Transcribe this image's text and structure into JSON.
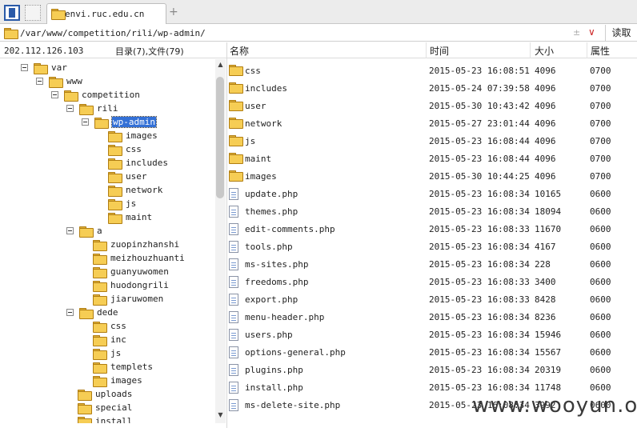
{
  "tabbar": {
    "tab_label": "envi.ruc.edu.cn",
    "add_symbol": "+"
  },
  "pathbar": {
    "path": "/var/www/competition/rili/wp-admin/",
    "star": "±",
    "dropdown": "∨",
    "read_label": "读取"
  },
  "left_header": {
    "ip": "202.112.126.103",
    "counts": "目录(7),文件(79)"
  },
  "tree": [
    {
      "label": "var",
      "expander": true
    },
    {
      "label": "www",
      "expander": true
    },
    {
      "label": "competition",
      "expander": true
    },
    {
      "label": "rili",
      "expander": true
    },
    {
      "label": "wp-admin",
      "expander": true,
      "selected": true
    },
    {
      "label": "images"
    },
    {
      "label": "css"
    },
    {
      "label": "includes"
    },
    {
      "label": "user"
    },
    {
      "label": "network"
    },
    {
      "label": "js"
    },
    {
      "label": "maint"
    },
    {
      "label": "a",
      "expander": true
    },
    {
      "label": "zuopinzhanshi"
    },
    {
      "label": "meizhouzhuanti"
    },
    {
      "label": "guanyuwomen"
    },
    {
      "label": "huodongrili"
    },
    {
      "label": "jiaruwomen"
    },
    {
      "label": "dede",
      "expander": true
    },
    {
      "label": "css"
    },
    {
      "label": "inc"
    },
    {
      "label": "js"
    },
    {
      "label": "templets"
    },
    {
      "label": "images"
    },
    {
      "label": "uploads"
    },
    {
      "label": "special"
    },
    {
      "label": "install"
    }
  ],
  "file_header": {
    "name": "名称",
    "time": "时间",
    "size": "大小",
    "perm": "属性"
  },
  "files": [
    {
      "name": "css",
      "time": "2015-05-23 16:08:51",
      "size": "4096",
      "perm": "0700",
      "type": "folder"
    },
    {
      "name": "includes",
      "time": "2015-05-24 07:39:58",
      "size": "4096",
      "perm": "0700",
      "type": "folder"
    },
    {
      "name": "user",
      "time": "2015-05-30 10:43:42",
      "size": "4096",
      "perm": "0700",
      "type": "folder"
    },
    {
      "name": "network",
      "time": "2015-05-27 23:01:44",
      "size": "4096",
      "perm": "0700",
      "type": "folder"
    },
    {
      "name": "js",
      "time": "2015-05-23 16:08:44",
      "size": "4096",
      "perm": "0700",
      "type": "folder"
    },
    {
      "name": "maint",
      "time": "2015-05-23 16:08:44",
      "size": "4096",
      "perm": "0700",
      "type": "folder"
    },
    {
      "name": "images",
      "time": "2015-05-30 10:44:25",
      "size": "4096",
      "perm": "0700",
      "type": "folder"
    },
    {
      "name": "update.php",
      "time": "2015-05-23 16:08:34",
      "size": "10165",
      "perm": "0600",
      "type": "file"
    },
    {
      "name": "themes.php",
      "time": "2015-05-23 16:08:34",
      "size": "18094",
      "perm": "0600",
      "type": "file"
    },
    {
      "name": "edit-comments.php",
      "time": "2015-05-23 16:08:33",
      "size": "11670",
      "perm": "0600",
      "type": "file"
    },
    {
      "name": "tools.php",
      "time": "2015-05-23 16:08:34",
      "size": "4167",
      "perm": "0600",
      "type": "file"
    },
    {
      "name": "ms-sites.php",
      "time": "2015-05-23 16:08:34",
      "size": "228",
      "perm": "0600",
      "type": "file"
    },
    {
      "name": "freedoms.php",
      "time": "2015-05-23 16:08:33",
      "size": "3400",
      "perm": "0600",
      "type": "file"
    },
    {
      "name": "export.php",
      "time": "2015-05-23 16:08:33",
      "size": "8428",
      "perm": "0600",
      "type": "file"
    },
    {
      "name": "menu-header.php",
      "time": "2015-05-23 16:08:34",
      "size": "8236",
      "perm": "0600",
      "type": "file"
    },
    {
      "name": "users.php",
      "time": "2015-05-23 16:08:34",
      "size": "15946",
      "perm": "0600",
      "type": "file"
    },
    {
      "name": "options-general.php",
      "time": "2015-05-23 16:08:34",
      "size": "15567",
      "perm": "0600",
      "type": "file"
    },
    {
      "name": "plugins.php",
      "time": "2015-05-23 16:08:34",
      "size": "20319",
      "perm": "0600",
      "type": "file"
    },
    {
      "name": "install.php",
      "time": "2015-05-23 16:08:34",
      "size": "11748",
      "perm": "0600",
      "type": "file"
    },
    {
      "name": "ms-delete-site.php",
      "time": "2015-05-23 16:08:34",
      "size": "3992",
      "perm": "0600",
      "type": "file"
    }
  ],
  "watermark": "www.wooyun.org"
}
